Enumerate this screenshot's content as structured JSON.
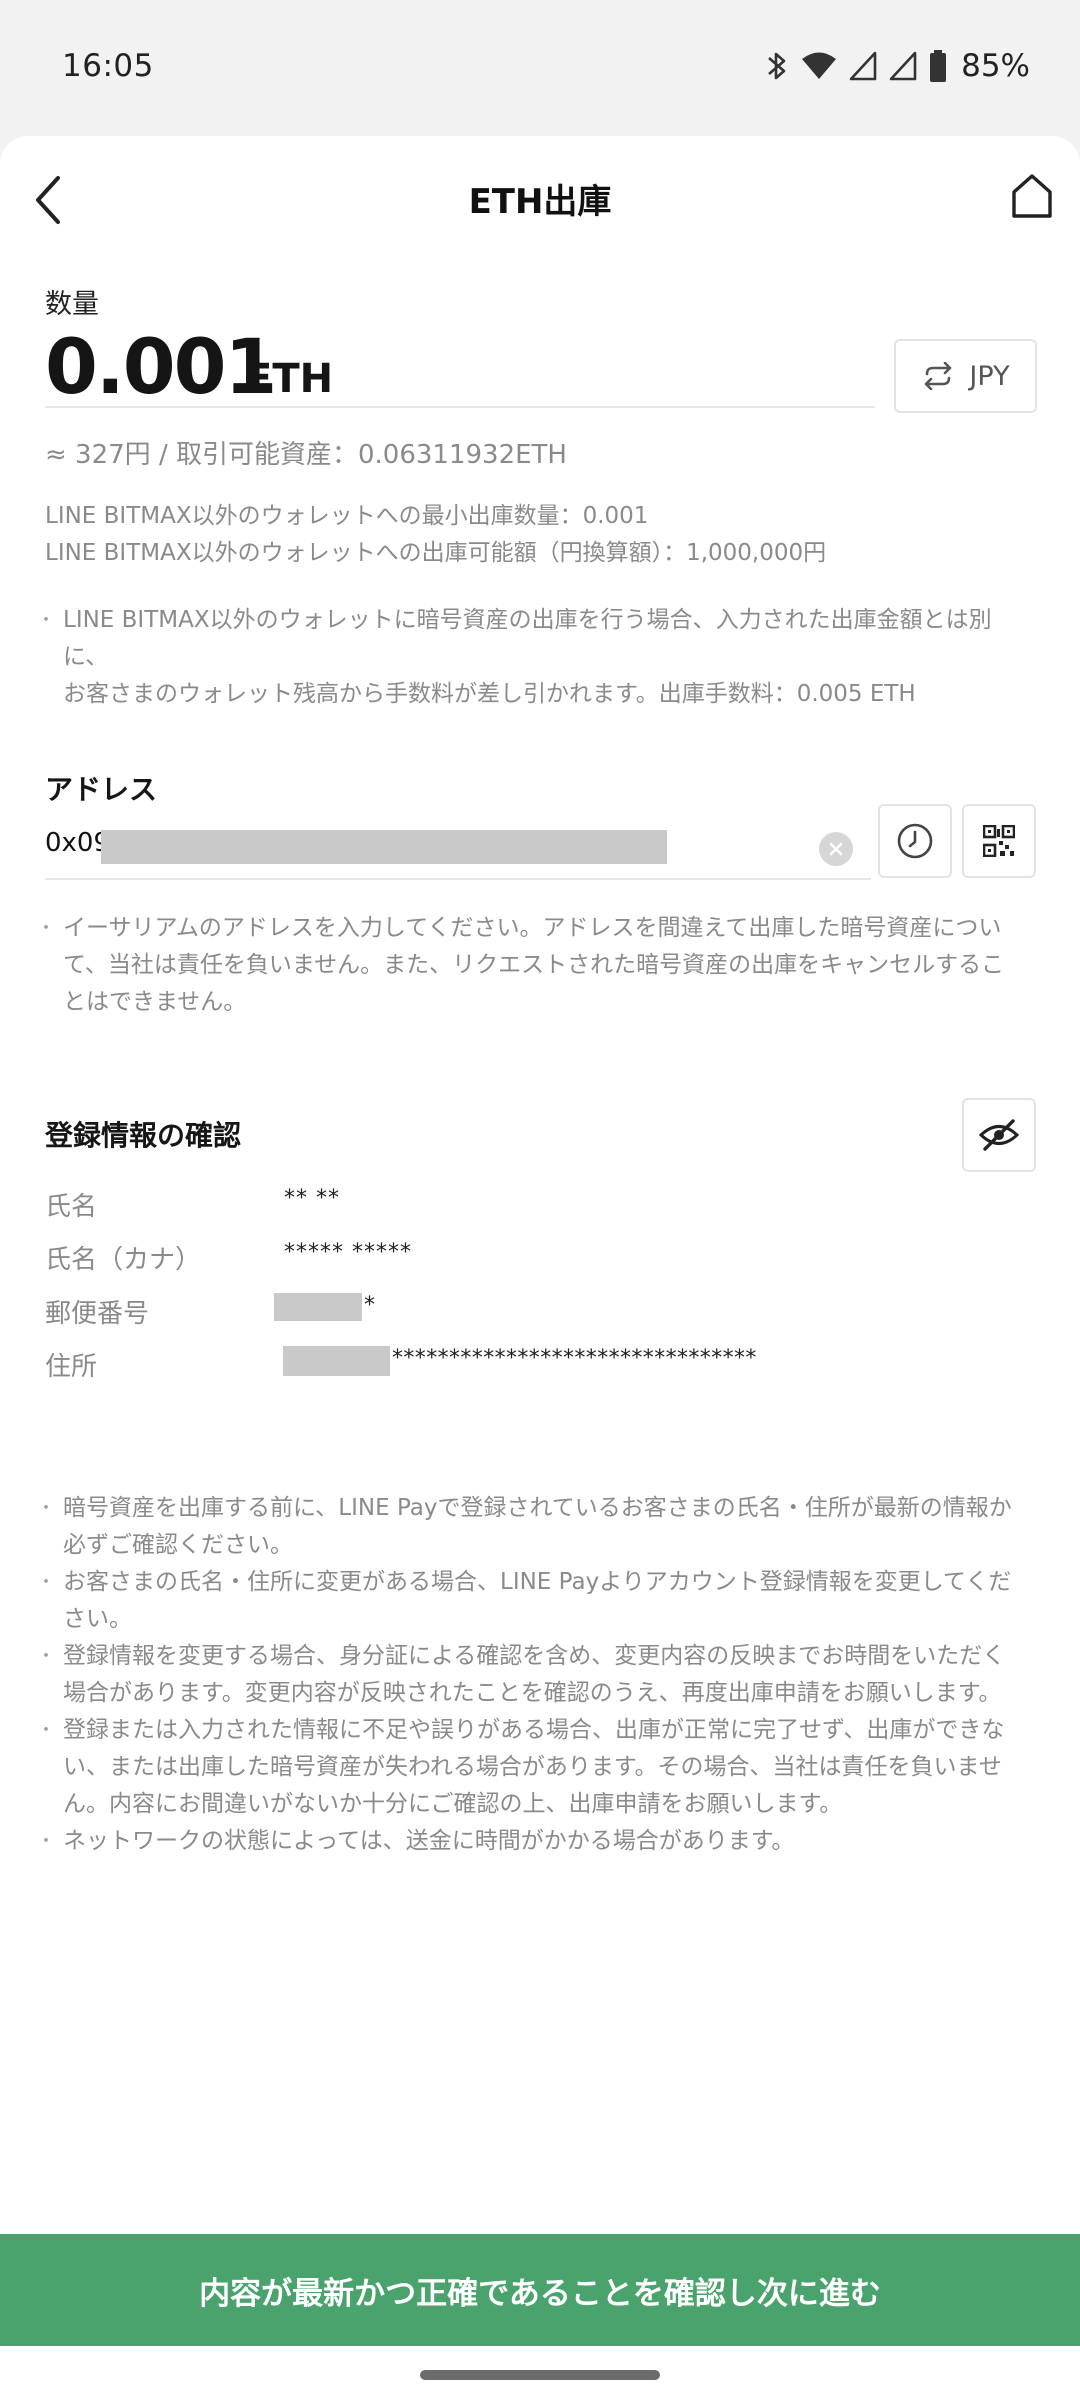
{
  "status_bar": {
    "time": "16:05",
    "battery": "85%",
    "icons": [
      "bluetooth-icon",
      "wifi-icon",
      "signal-icon",
      "signal-icon",
      "battery-icon"
    ]
  },
  "header": {
    "title": "ETH出庫",
    "back_icon": "chevron-left-icon",
    "home_icon": "home-icon"
  },
  "quantity": {
    "label": "数量",
    "value": "0.001",
    "unit": "ETH",
    "toggle_label": "JPY",
    "toggle_icon": "swap-icon",
    "summary": "≈ 327円 / 取引可能資産：0.06311932ETH"
  },
  "limits": {
    "min": "LINE BITMAX以外のウォレットへの最小出庫数量：0.001",
    "max": "LINE BITMAX以外のウォレットへの出庫可能額（円換算額）：1,000,000円"
  },
  "fee_note": {
    "line1": "LINE BITMAX以外のウォレットに暗号資産の出庫を行う場合、入力された出庫金額とは別に、",
    "line2": "お客さまのウォレット残高から手数料が差し引かれます。出庫手数料：0.005 ETH"
  },
  "address": {
    "label": "アドレス",
    "value_prefix": "0x09",
    "note_line1": "イーサリアムのアドレスを入力してください。アドレスを間違えて出庫した暗号資産につい",
    "note_line2": "て、当社は責任を負いません。また、リクエストされた暗号資産の出庫をキャンセルするこ",
    "note_line3": "とはできません。"
  },
  "registration": {
    "title": "登録情報の確認",
    "name_label": "氏名",
    "name_value": "** **",
    "kana_label": "氏名（カナ）",
    "kana_value": "***** *****",
    "postal_label": "郵便番号",
    "postal_value": "*",
    "address_label": "住所",
    "address_value": "********************************"
  },
  "notes": [
    [
      "暗号資産を出庫する前に、LINE Payで登録されているお客さまの氏名・住所が最新の情報か",
      "必ずご確認ください。"
    ],
    [
      "お客さまの氏名・住所に変更がある場合、LINE Payよりアカウント登録情報を変更してくだ",
      "さい。"
    ],
    [
      "登録情報を変更する場合、身分証による確認を含め、変更内容の反映までお時間をいただく",
      "場合があります。変更内容が反映されたことを確認のうえ、再度出庫申請をお願いします。"
    ],
    [
      "登録または入力された情報に不足や誤りがある場合、出庫が正常に完了せず、出庫ができな",
      "い、または出庫した暗号資産が失われる場合があります。その場合、当社は責任を負いませ",
      "ん。内容にお間違いがないか十分にご確認の上、出庫申請をお願いします。"
    ],
    [
      "ネットワークの状態によっては、送金に時間がかかる場合があります。"
    ]
  ],
  "cta": {
    "label": "内容が最新かつ正確であることを確認し次に進む"
  },
  "colors": {
    "accent": "#4aa36c",
    "muted_text": "#8a8a8a",
    "redaction": "#c9c9c9"
  }
}
